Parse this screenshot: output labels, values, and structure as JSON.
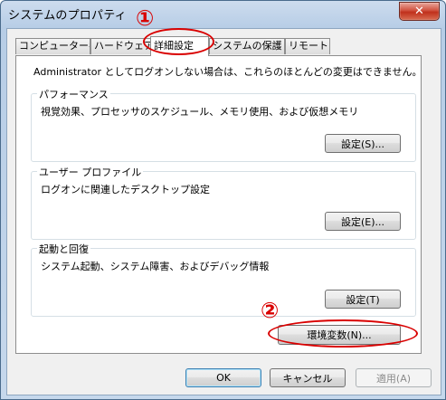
{
  "window": {
    "title": "システムのプロパティ",
    "close_glyph": "✕"
  },
  "tabs": [
    {
      "label": "コンピューター名"
    },
    {
      "label": "ハードウェア"
    },
    {
      "label": "詳細設定"
    },
    {
      "label": "システムの保護"
    },
    {
      "label": "リモート"
    }
  ],
  "active_tab": "詳細設定",
  "panel": {
    "note": "Administrator としてログオンしない場合は、これらのほとんどの変更はできません。",
    "groups": [
      {
        "title": "パフォーマンス",
        "desc": "視覚効果、プロセッサのスケジュール、メモリ使用、および仮想メモリ",
        "button": "設定(S)..."
      },
      {
        "title": "ユーザー プロファイル",
        "desc": "ログオンに関連したデスクトップ設定",
        "button": "設定(E)..."
      },
      {
        "title": "起動と回復",
        "desc": "システム起動、システム障害、およびデバッグ情報",
        "button": "設定(T)"
      }
    ],
    "env_button": "環境変数(N)..."
  },
  "footer": {
    "ok": "OK",
    "cancel": "キャンセル",
    "apply": "適用(A)"
  },
  "annotations": {
    "step1": "①",
    "step2": "②",
    "color": "#d90000"
  }
}
